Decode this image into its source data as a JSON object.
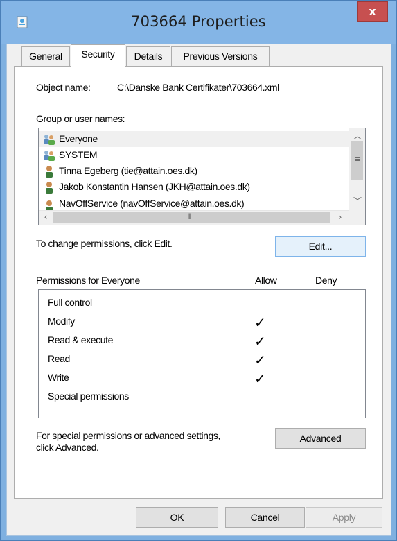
{
  "window": {
    "title": "703664 Properties",
    "close_glyph": "x"
  },
  "tabs": [
    {
      "label": "General"
    },
    {
      "label": "Security"
    },
    {
      "label": "Details"
    },
    {
      "label": "Previous Versions"
    }
  ],
  "object": {
    "label": "Object name:",
    "value": "C:\\Danske Bank Certifikater\\703664.xml"
  },
  "groups": {
    "label": "Group or user names:",
    "items": [
      {
        "name": "Everyone",
        "icon": "group-icon"
      },
      {
        "name": "SYSTEM",
        "icon": "group-icon"
      },
      {
        "name": "Tinna Egeberg (tie@attain.oes.dk)",
        "icon": "user-icon"
      },
      {
        "name": "Jakob Konstantin Hansen (JKH@attain.oes.dk)",
        "icon": "user-icon"
      },
      {
        "name": "NavOffService (navOffService@attain.oes.dk)",
        "icon": "user-icon"
      }
    ],
    "selected_index": 0
  },
  "change": {
    "text": "To change permissions, click Edit.",
    "edit_label": "Edit..."
  },
  "permissions": {
    "title": "Permissions for Everyone",
    "allow_header": "Allow",
    "deny_header": "Deny",
    "check_glyph": "✓",
    "rows": [
      {
        "name": "Full control",
        "allow": false,
        "deny": false
      },
      {
        "name": "Modify",
        "allow": true,
        "deny": false
      },
      {
        "name": "Read & execute",
        "allow": true,
        "deny": false
      },
      {
        "name": "Read",
        "allow": true,
        "deny": false
      },
      {
        "name": "Write",
        "allow": true,
        "deny": false
      },
      {
        "name": "Special permissions",
        "allow": false,
        "deny": false
      }
    ]
  },
  "advanced": {
    "line1": "For special permissions or advanced settings,",
    "line2": "click Advanced.",
    "button_label": "Advanced"
  },
  "buttons": {
    "ok": "OK",
    "cancel": "Cancel",
    "apply": "Apply"
  },
  "colors": {
    "titlebar": "#84b5e6",
    "close": "#c75050",
    "face": "#f0f0f0",
    "selection": "#f0f0f0"
  }
}
